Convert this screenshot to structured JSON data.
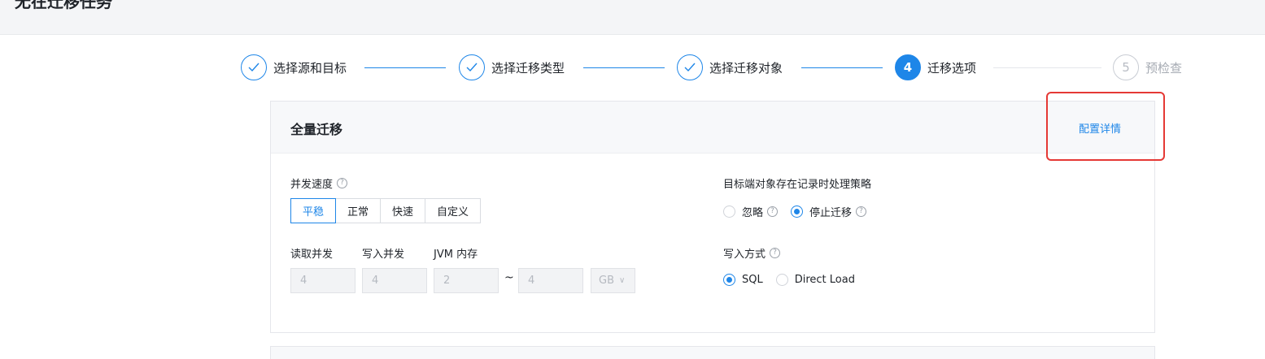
{
  "page": {
    "title": "无在迁移任务"
  },
  "steps": [
    {
      "label": "选择源和目标",
      "state": "done",
      "icon": "check-icon"
    },
    {
      "label": "选择迁移类型",
      "state": "done",
      "icon": "check-icon"
    },
    {
      "label": "选择迁移对象",
      "state": "done",
      "icon": "check-icon"
    },
    {
      "label": "迁移选项",
      "state": "active",
      "number": "4"
    },
    {
      "label": "预检查",
      "state": "pending",
      "number": "5"
    }
  ],
  "card": {
    "title": "全量迁移",
    "config_link": "配置详情",
    "concurrency": {
      "label": "并发速度",
      "options": [
        "平稳",
        "正常",
        "快速",
        "自定义"
      ],
      "selected": "平稳"
    },
    "read_concurrency": {
      "label": "读取并发",
      "value": "4"
    },
    "write_concurrency": {
      "label": "写入并发",
      "value": "4"
    },
    "jvm_memory": {
      "label": "JVM 内存",
      "min": "2",
      "separator": "~",
      "max": "4",
      "unit": "GB"
    },
    "conflict_strategy": {
      "label": "目标端对象存在记录时处理策略",
      "options": [
        "忽略",
        "停止迁移"
      ],
      "selected": "停止迁移"
    },
    "write_mode": {
      "label": "写入方式",
      "options": [
        "SQL",
        "Direct Load"
      ],
      "selected": "SQL"
    }
  },
  "colors": {
    "accent": "#1e86e8",
    "highlight": "#e53935"
  }
}
